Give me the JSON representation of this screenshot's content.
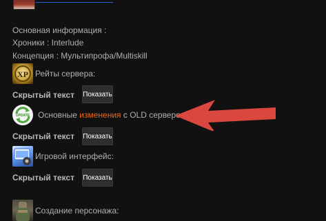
{
  "general_info": {
    "heading": "Основная информация :",
    "chronicles": "Хроники : Interlude",
    "concept": "Концепция : Мультипрофа/Multiskill"
  },
  "sections": {
    "rates": {
      "label": "Рейты сервера:"
    },
    "changes": {
      "label_before": "Основные ",
      "label_highlight": "изменения",
      "label_after": " с OLD сервером :"
    },
    "interface": {
      "label": "Игровой интерфейс:"
    },
    "character": {
      "label": "Создание персонажа:"
    }
  },
  "spoiler": {
    "hidden_text": "Скрытый текст",
    "show_button": "Показать"
  },
  "colors": {
    "background": "#111111",
    "text": "#b0b0b0",
    "highlight": "#e86a1a",
    "arrow": "#d9473f"
  },
  "icons": {
    "rates": "xp-icon",
    "changes": "update-icon",
    "interface": "gui-icon",
    "character": "character-icon"
  }
}
